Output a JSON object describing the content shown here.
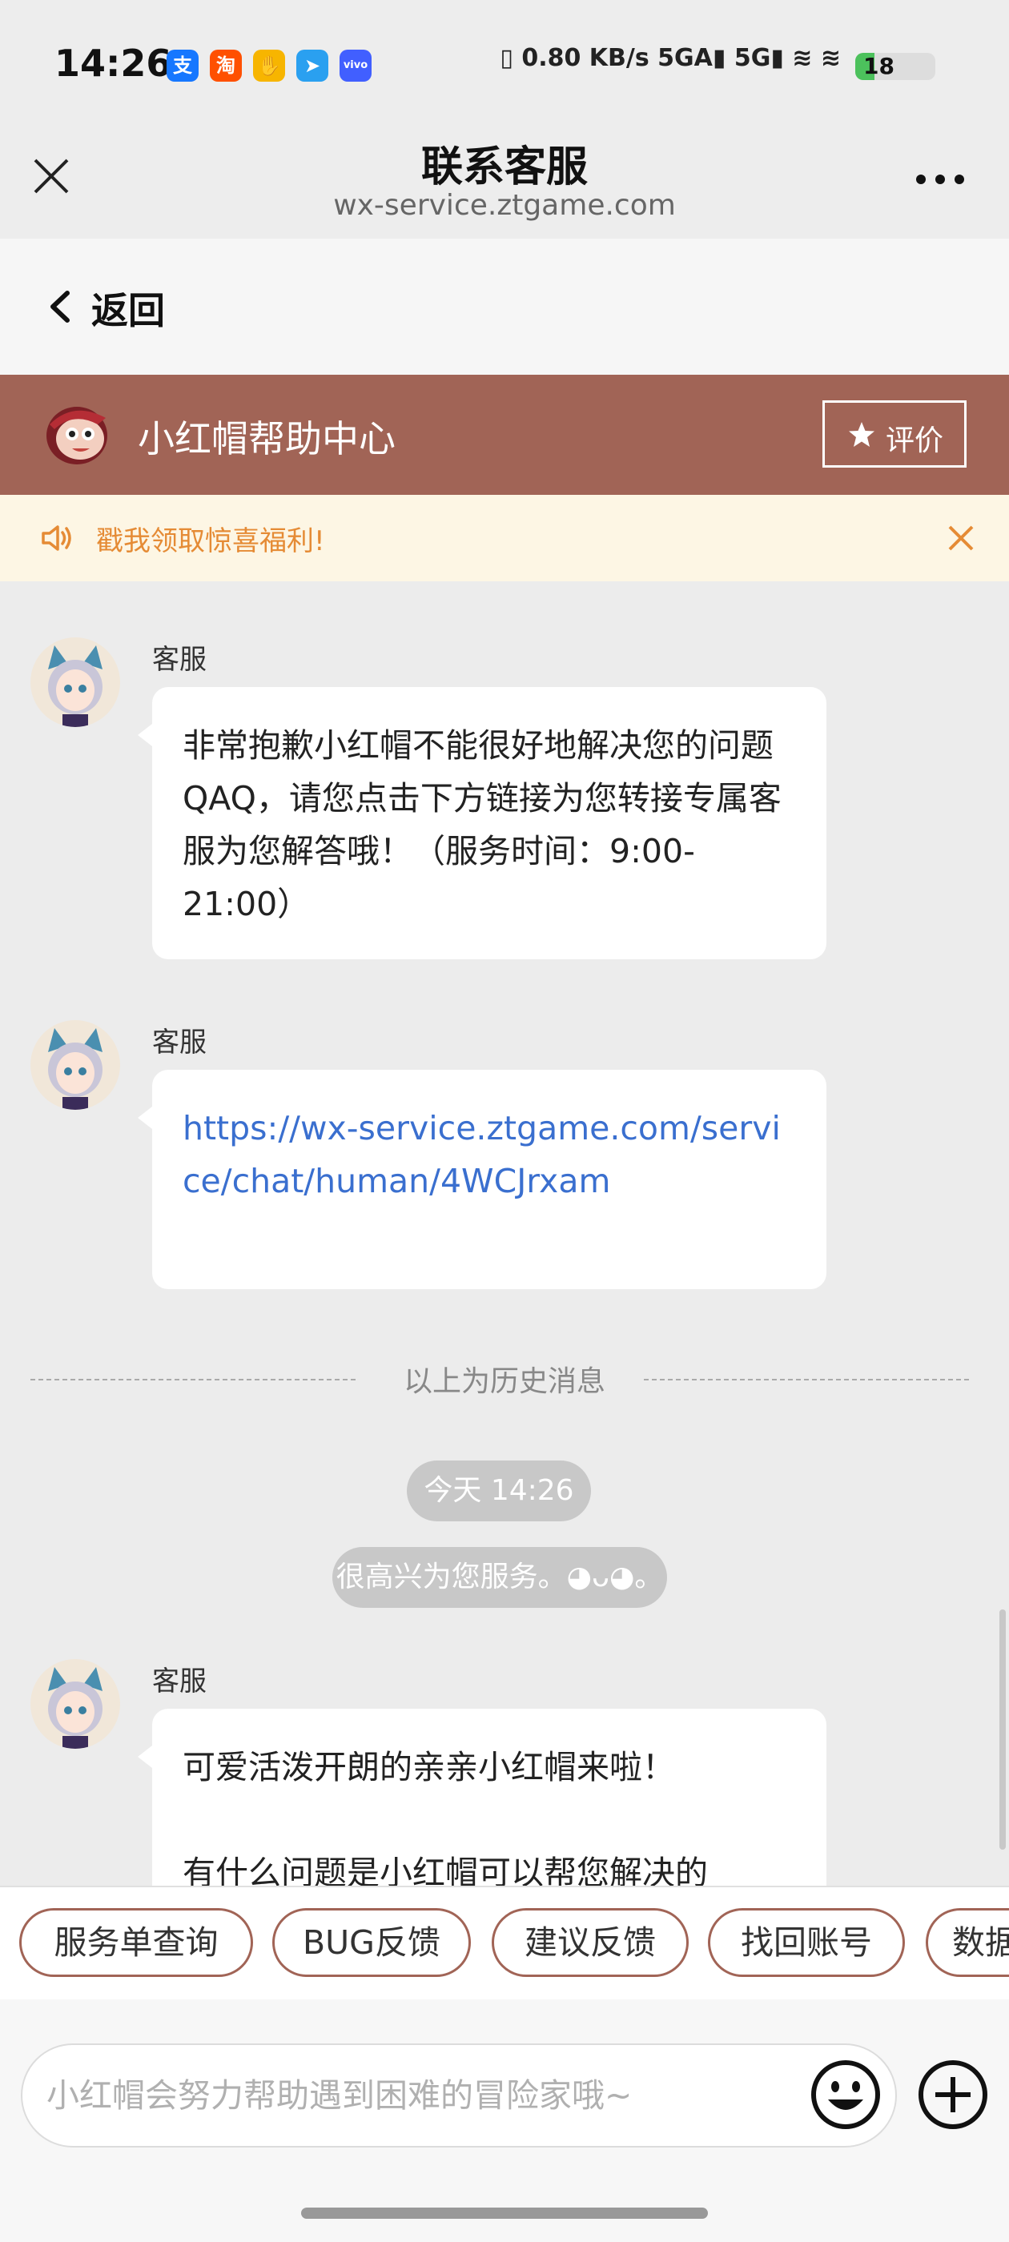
{
  "status_bar": {
    "time": "14:26",
    "app_icons": [
      {
        "name": "alipay-icon",
        "glyph": "支",
        "color": "#1677ff"
      },
      {
        "name": "taobao-icon",
        "glyph": "淘",
        "color": "#ff5000"
      },
      {
        "name": "fingerprint-app-icon",
        "glyph": "✋",
        "color": "#f7b500"
      },
      {
        "name": "paper-plane-app-icon",
        "glyph": "➤",
        "color": "#2aa0f0"
      },
      {
        "name": "vivo-app-icon",
        "glyph": "vivo",
        "color": "#415fff"
      }
    ],
    "indicators": "▯ 0.80 KB/s 5GA▮ 5G▮ ≋ ≋",
    "battery": "18"
  },
  "titlebar": {
    "title": "联系客服",
    "url": "wx-service.ztgame.com"
  },
  "back": {
    "label": "返回"
  },
  "header": {
    "title": "小红帽帮助中心",
    "rate_label": "评价"
  },
  "notice": {
    "text": "戳我领取惊喜福利!"
  },
  "messages": [
    {
      "sender": "客服",
      "text": "非常抱歉小红帽不能很好地解决您的问题QAQ，请您点击下方链接为您转接专属客服为您解答哦！（服务时间：9:00-21:00）"
    },
    {
      "sender": "客服",
      "text": "https://wx-service.ztgame.com/service/chat/human/4WCJrxam"
    },
    {
      "sender": "客服",
      "text": "可爱活泼开朗的亲亲小红帽来啦！\n\n有什么问题是小红帽可以帮您解决的"
    }
  ],
  "history_divider": "以上为历史消息",
  "timestamp": "今天 14:26",
  "system_message": "很高兴为您服务。◕ᴗ◕。",
  "quick_actions": [
    "服务单查询",
    "BUG反馈",
    "建议反馈",
    "找回账号",
    "数据"
  ],
  "input": {
    "placeholder": "小红帽会努力帮助遇到困难的冒险家哦~"
  },
  "colors": {
    "brand": "#a16456",
    "notice_bg": "#fdf6e4",
    "notice_text": "#e58b35",
    "link": "#3a6fcf"
  }
}
